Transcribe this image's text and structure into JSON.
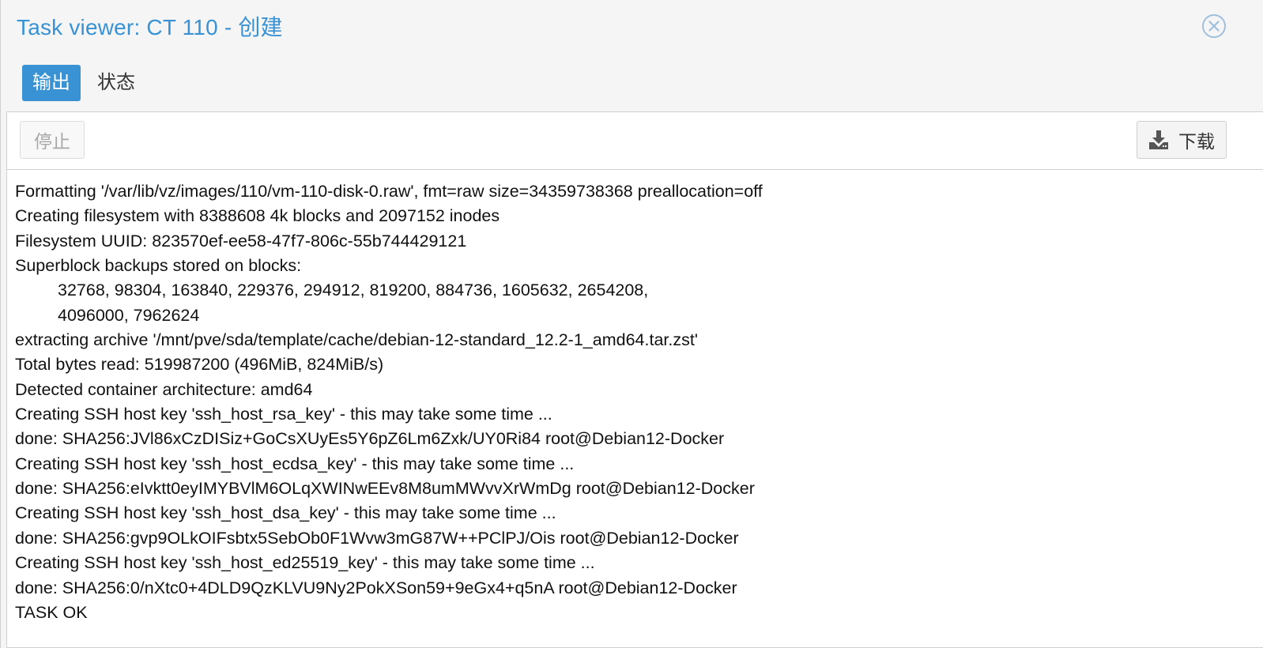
{
  "window": {
    "title": "Task viewer: CT 110 - 创建",
    "close_icon": "close-circle-icon"
  },
  "tabs": [
    {
      "label": "输出",
      "active": true
    },
    {
      "label": "状态",
      "active": false
    }
  ],
  "toolbar": {
    "stop_label": "停止",
    "stop_enabled": false,
    "download_label": "下载",
    "download_icon": "download-icon"
  },
  "log_lines": [
    {
      "text": "Formatting '/var/lib/vz/images/110/vm-110-disk-0.raw', fmt=raw size=34359738368 preallocation=off",
      "indent": false
    },
    {
      "text": "Creating filesystem with 8388608 4k blocks and 2097152 inodes",
      "indent": false
    },
    {
      "text": "Filesystem UUID: 823570ef-ee58-47f7-806c-55b744429121",
      "indent": false
    },
    {
      "text": "Superblock backups stored on blocks:",
      "indent": false
    },
    {
      "text": "32768, 98304, 163840, 229376, 294912, 819200, 884736, 1605632, 2654208,",
      "indent": true
    },
    {
      "text": "4096000, 7962624",
      "indent": true
    },
    {
      "text": "extracting archive '/mnt/pve/sda/template/cache/debian-12-standard_12.2-1_amd64.tar.zst'",
      "indent": false
    },
    {
      "text": "Total bytes read: 519987200 (496MiB, 824MiB/s)",
      "indent": false
    },
    {
      "text": "Detected container architecture: amd64",
      "indent": false
    },
    {
      "text": "Creating SSH host key 'ssh_host_rsa_key' - this may take some time ...",
      "indent": false
    },
    {
      "text": "done: SHA256:JVl86xCzDISiz+GoCsXUyEs5Y6pZ6Lm6Zxk/UY0Ri84 root@Debian12-Docker",
      "indent": false
    },
    {
      "text": "Creating SSH host key 'ssh_host_ecdsa_key' - this may take some time ...",
      "indent": false
    },
    {
      "text": "done: SHA256:eIvktt0eyIMYBVlM6OLqXWINwEEv8M8umMWvvXrWmDg root@Debian12-Docker",
      "indent": false
    },
    {
      "text": "Creating SSH host key 'ssh_host_dsa_key' - this may take some time ...",
      "indent": false
    },
    {
      "text": "done: SHA256:gvp9OLkOIFsbtx5SebOb0F1Wvw3mG87W++PClPJ/Ois root@Debian12-Docker",
      "indent": false
    },
    {
      "text": "Creating SSH host key 'ssh_host_ed25519_key' - this may take some time ...",
      "indent": false
    },
    {
      "text": "done: SHA256:0/nXtc0+4DLD9QzKLVU9Ny2PokXSon59+9eGx4+q5nA root@Debian12-Docker",
      "indent": false
    },
    {
      "text": "TASK OK",
      "indent": false
    }
  ],
  "colors": {
    "accent": "#3892d4",
    "background": "#f5f5f5",
    "panel": "#ffffff",
    "border": "#cfcfcf"
  }
}
